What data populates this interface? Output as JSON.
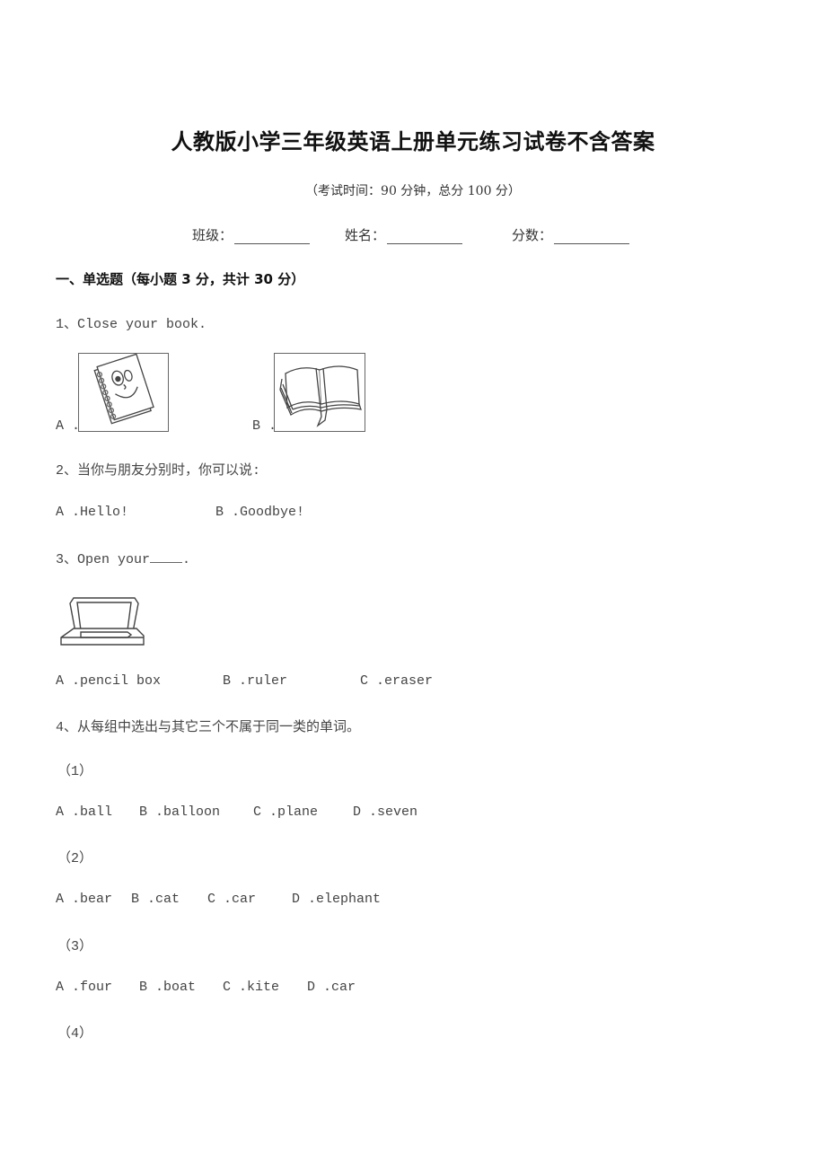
{
  "document": {
    "title": "人教版小学三年级英语上册单元练习试卷不含答案",
    "subtitle": "（考试时间：90 分钟，总分 100 分）",
    "fields": [
      {
        "label": "班级：",
        "value": ""
      },
      {
        "label": "姓名：",
        "value": ""
      },
      {
        "label": "分数：",
        "value": ""
      }
    ],
    "section_heading": "一、单选题（每小题 3 分，共计 30 分）"
  },
  "questions": {
    "q1": {
      "prompt": "1、Close your book.",
      "options": [
        {
          "label": "A .",
          "image": "notebook-cartoon-image"
        },
        {
          "label": "B .",
          "image": "open-book-image"
        }
      ]
    },
    "q2": {
      "prompt": "2、当你与朋友分别时，你可以说:",
      "options": [
        "A .Hello!",
        "B .Goodbye!"
      ]
    },
    "q3": {
      "prompt_prefix": "3、Open your",
      "prompt_suffix": ".",
      "image": "pencil-box-image",
      "options": [
        "A .pencil box",
        "B .ruler",
        "C .eraser"
      ]
    },
    "q4": {
      "prompt": "4、从每组中选出与其它三个不属于同一类的单词。",
      "groups": [
        {
          "label": "（1）",
          "options": [
            "A .ball",
            "B .balloon",
            "C .plane",
            "D .seven"
          ]
        },
        {
          "label": "（2）",
          "options": [
            "A .bear",
            "B .cat",
            "C .car",
            "D .elephant"
          ]
        },
        {
          "label": "（3）",
          "options": [
            "A .four",
            "B .boat",
            "C .kite",
            "D .car"
          ]
        },
        {
          "label": "（4）",
          "options": []
        }
      ]
    }
  }
}
